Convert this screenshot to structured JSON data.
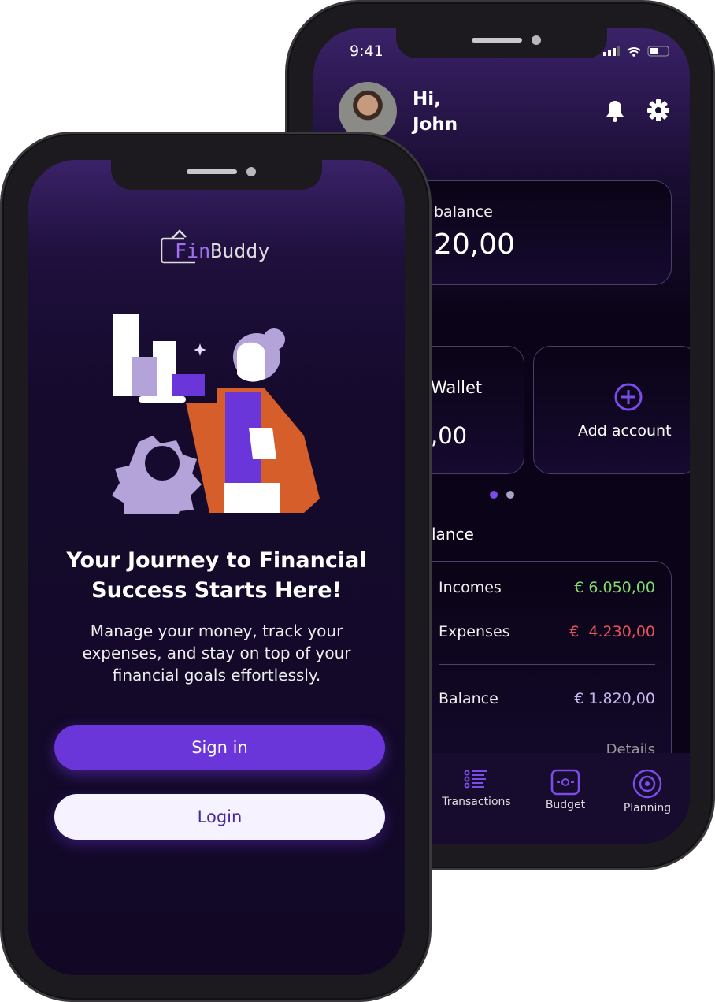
{
  "back_phone": {
    "status": {
      "time": "9:41"
    },
    "greeting": {
      "hi": "Hi,",
      "name": "John"
    },
    "balance_card": {
      "label": "balance",
      "amount": "20,00"
    },
    "accounts": {
      "wallet_label": "Wallet",
      "wallet_amount": ",00",
      "add_account": "Add account"
    },
    "section_title": "lance",
    "summary": {
      "incomes_label": "Incomes",
      "incomes_value": "€ 6.050,00",
      "expenses_label": "Expenses",
      "expenses_value": "€  4.230,00",
      "balance_label": "Balance",
      "balance_value": "€ 1.820,00",
      "details": "Details"
    },
    "nav": [
      {
        "label": "Transactions",
        "icon": "list-icon"
      },
      {
        "label": "Budget",
        "icon": "wallet-icon"
      },
      {
        "label": "Planning",
        "icon": "target-icon"
      }
    ],
    "colors": {
      "income": "#7fdc6a",
      "expense": "#e5545a",
      "balance": "#c9b8f0",
      "accent": "#7a4ce8"
    }
  },
  "front_phone": {
    "logo": {
      "fin": "Fin",
      "buddy": "Buddy"
    },
    "headline": "Your Journey to Financial Success Starts Here!",
    "subtitle": "Manage your money, track your expenses, and stay on top of your financial goals effortlessly.",
    "sign_in": "Sign in",
    "login": "Login",
    "colors": {
      "primary": "#6a35d9",
      "secondary": "#f7f2ff"
    }
  }
}
